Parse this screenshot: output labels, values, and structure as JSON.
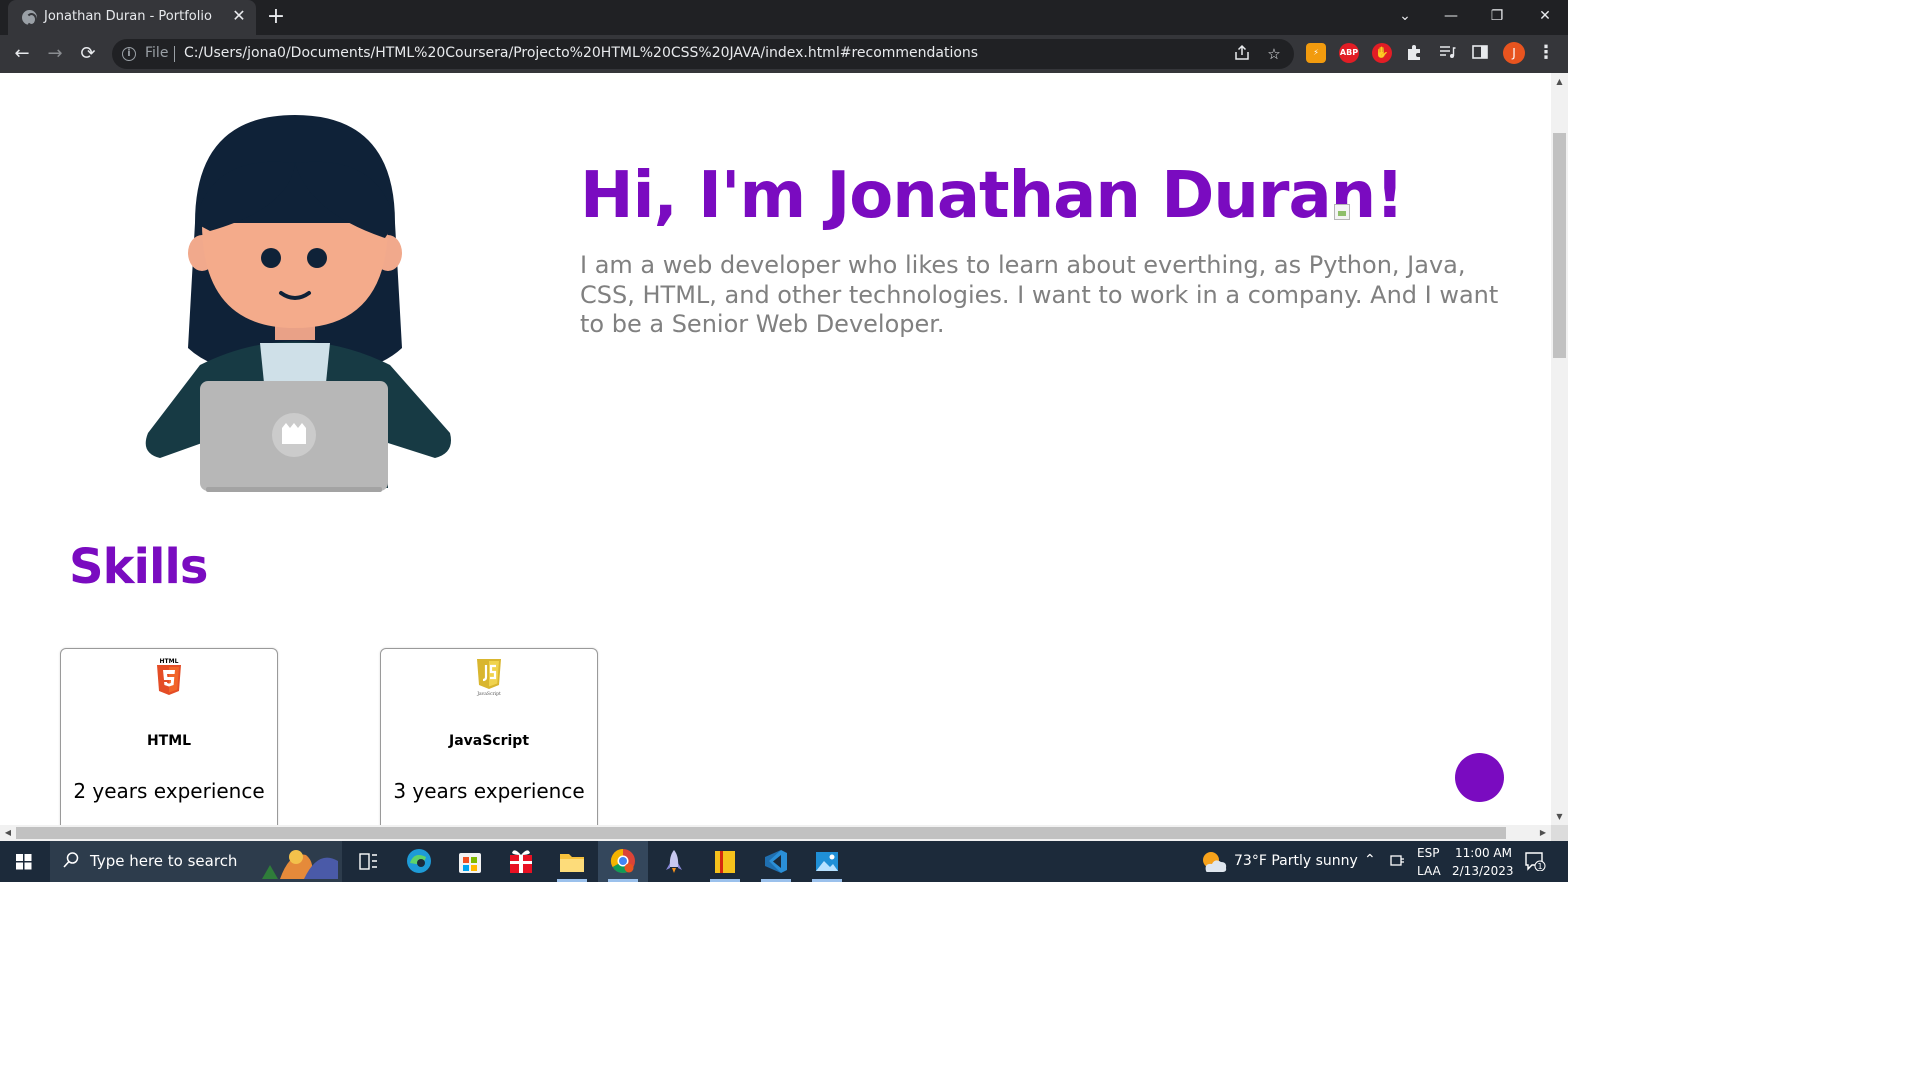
{
  "browser": {
    "tab_title": "Jonathan Duran - Portfolio",
    "tab_close": "✕",
    "new_tab": "+",
    "window_controls": {
      "list": "⌄",
      "minimize": "—",
      "restore": "❐",
      "close": "✕"
    },
    "nav": {
      "back": "←",
      "forward": "→",
      "reload": "⟳"
    },
    "file_label": "File",
    "url": "C:/Users/jona0/Documents/HTML%20Coursera/Projecto%20HTML%20CSS%20JAVA/index.html#recommendations",
    "profile_initial": "J",
    "ext_abp": "ABP"
  },
  "page": {
    "hero_title": "Hi, I'm Jonathan Duran!",
    "hero_description": "I am a web developer who likes to learn about everthing, as Python, Java, CSS, HTML, and other technologies. I want to work in a company. And I want to be a Senior Web Developer.",
    "skills_title": "Skills",
    "skills": [
      {
        "name": "HTML",
        "experience": "2 years experience",
        "logo_label": "HTML"
      },
      {
        "name": "JavaScript",
        "experience": "3 years experience",
        "logo_label": "JavaScript"
      }
    ],
    "accent_color": "#7a0bc0",
    "text_gray": "#808080"
  },
  "taskbar": {
    "search_placeholder": "Type here to search",
    "weather": "73°F  Partly sunny",
    "lang_top": "ESP",
    "lang_bottom": "LAA",
    "time": "11:00 AM",
    "date": "2/13/2023",
    "notification_count": "1"
  }
}
